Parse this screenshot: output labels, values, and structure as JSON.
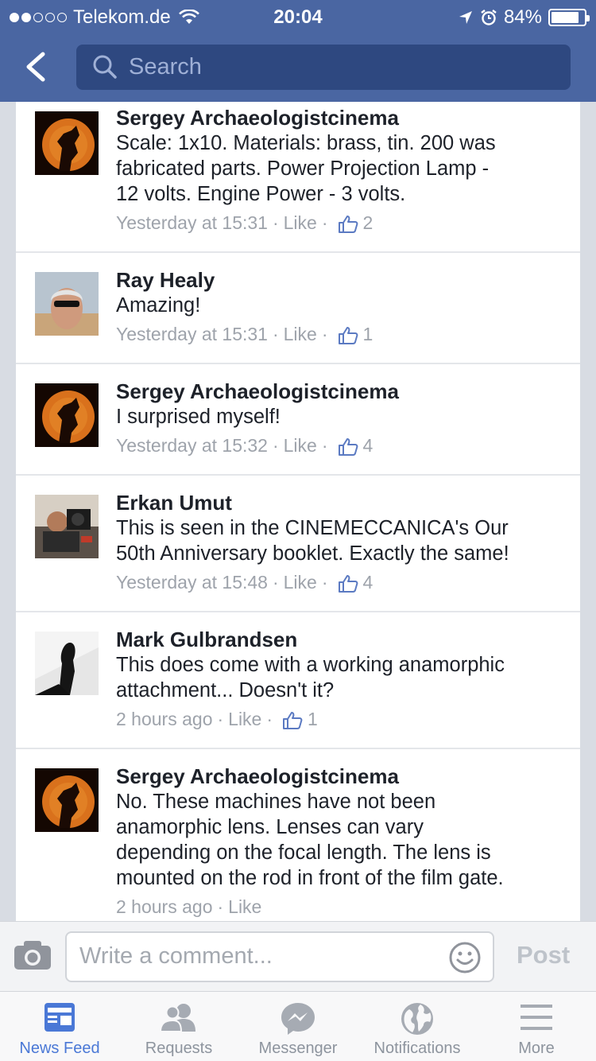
{
  "status": {
    "carrier": "Telekom.de",
    "time": "20:04",
    "battery": "84%",
    "battery_level": 0.84
  },
  "header": {
    "search_placeholder": "Search"
  },
  "comments": [
    {
      "author": "Sergey Archaeologistcinema",
      "lines": [
        "Scale: 1x10. Materials: brass, tin. 200 was",
        "fabricated parts. Power Projection Lamp -",
        "12 volts. Engine Power - 3 volts."
      ],
      "time": "Yesterday at 15:31",
      "like": "Like",
      "likes": "2"
    },
    {
      "author": "Ray Healy",
      "lines": [
        "Amazing!"
      ],
      "time": "Yesterday at 15:31",
      "like": "Like",
      "likes": "1"
    },
    {
      "author": "Sergey Archaeologistcinema",
      "lines": [
        "I surprised myself!"
      ],
      "time": "Yesterday at 15:32",
      "like": "Like",
      "likes": "4"
    },
    {
      "author": "Erkan Umut",
      "lines": [
        "This is seen in the CINEMECCANICA's Our",
        "50th Anniversary booklet. Exactly the same!"
      ],
      "time": "Yesterday at 15:48",
      "like": "Like",
      "likes": "4"
    },
    {
      "author": "Mark Gulbrandsen",
      "lines": [
        "This does come with a working anamorphic",
        "attachment... Doesn't it?"
      ],
      "time": "2 hours ago",
      "like": "Like",
      "likes": "1"
    },
    {
      "author": "Sergey Archaeologistcinema",
      "lines": [
        "No. These machines have not been",
        "anamorphic lens. Lenses can vary",
        "depending on the focal length. The lens is",
        "mounted on the rod in front of the film gate."
      ],
      "time": "2 hours ago",
      "like": "Like",
      "likes": ""
    }
  ],
  "composer": {
    "placeholder": "Write a comment...",
    "post_label": "Post"
  },
  "tabs": [
    {
      "label": "News Feed",
      "icon": "news-feed-icon",
      "active": true
    },
    {
      "label": "Requests",
      "icon": "requests-icon",
      "active": false
    },
    {
      "label": "Messenger",
      "icon": "messenger-icon",
      "active": false
    },
    {
      "label": "Notifications",
      "icon": "globe-icon",
      "active": false
    },
    {
      "label": "More",
      "icon": "menu-icon",
      "active": false
    }
  ],
  "colors": {
    "header": "#4a66a2",
    "active_tab": "#4a78d6",
    "meta_text": "#9ea3ab"
  }
}
